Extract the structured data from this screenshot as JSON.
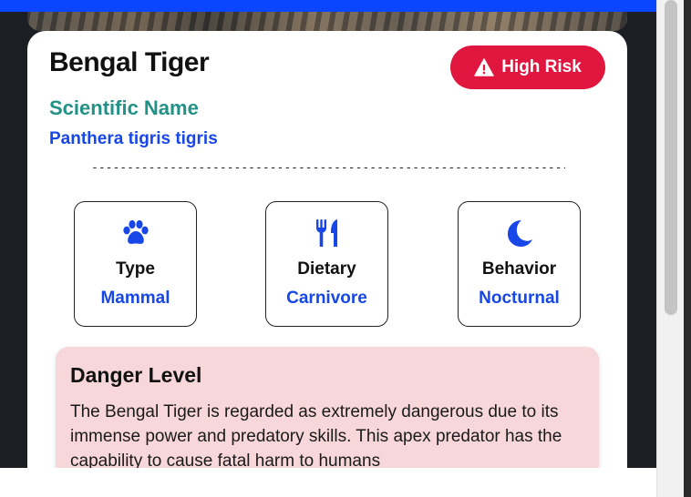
{
  "colors": {
    "top_bar": "#0a45ff",
    "risk_button": "#e0163f",
    "scientific_label": "#229186",
    "link_blue": "#1747e8",
    "danger_bg": "#f8d7da"
  },
  "header": {
    "title": "Bengal Tiger",
    "risk_label": "High Risk",
    "risk_icon": "warning-triangle-icon"
  },
  "scientific": {
    "label": "Scientific Name",
    "value": "Panthera tigris tigris"
  },
  "divider": "------------------------------------------------------------------------",
  "info_cards": [
    {
      "icon": "paw-icon",
      "label": "Type",
      "value": "Mammal"
    },
    {
      "icon": "utensils-icon",
      "label": "Dietary",
      "value": "Carnivore"
    },
    {
      "icon": "moon-icon",
      "label": "Behavior",
      "value": "Nocturnal"
    }
  ],
  "danger": {
    "title": "Danger Level",
    "text": "The Bengal Tiger is regarded as extremely dangerous due to its immense power and predatory skills. This apex predator has the capability to cause fatal harm to humans"
  }
}
